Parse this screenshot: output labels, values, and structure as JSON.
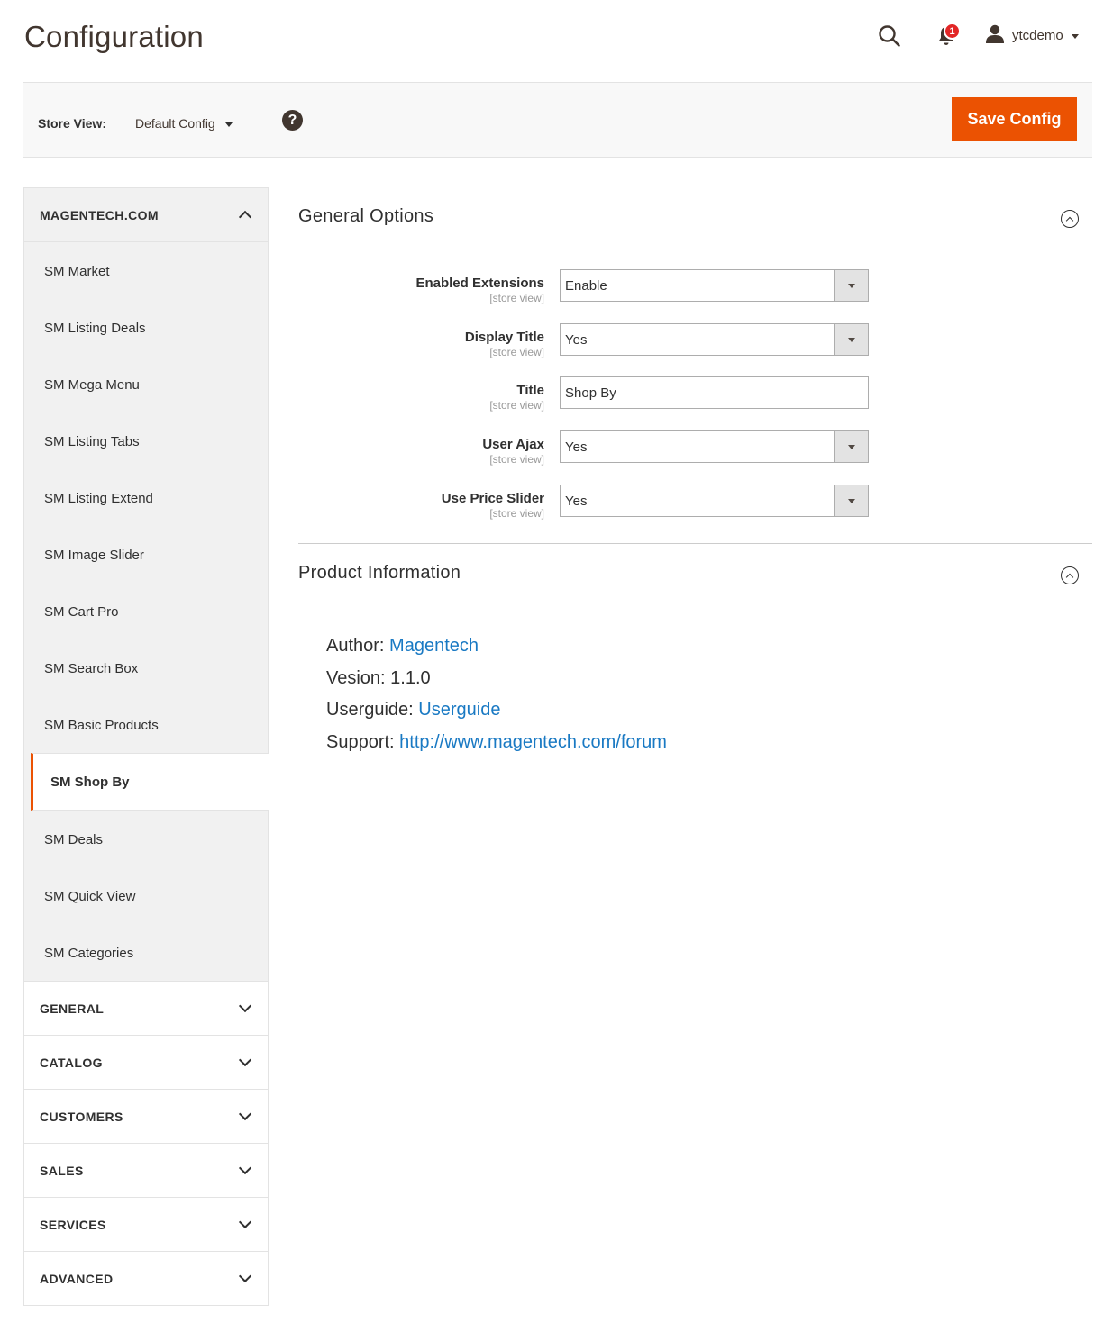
{
  "header": {
    "title": "Configuration",
    "notifications_count": "1",
    "username": "ytcdemo"
  },
  "store_bar": {
    "label": "Store View:",
    "selected": "Default Config",
    "help": "?",
    "save_label": "Save Config"
  },
  "sidebar": {
    "main_section": "MAGENTECH.COM",
    "items": [
      {
        "label": "SM Market"
      },
      {
        "label": "SM Listing Deals"
      },
      {
        "label": "SM Mega Menu"
      },
      {
        "label": "SM Listing Tabs"
      },
      {
        "label": "SM Listing Extend"
      },
      {
        "label": "SM Image Slider"
      },
      {
        "label": "SM Cart Pro"
      },
      {
        "label": "SM Search Box"
      },
      {
        "label": "SM Basic Products"
      },
      {
        "label": "SM Shop By"
      },
      {
        "label": "SM Deals"
      },
      {
        "label": "SM Quick View"
      },
      {
        "label": "SM Categories"
      }
    ],
    "active_item": "SM Shop By",
    "sections": [
      {
        "label": "GENERAL"
      },
      {
        "label": "CATALOG"
      },
      {
        "label": "CUSTOMERS"
      },
      {
        "label": "SALES"
      },
      {
        "label": "SERVICES"
      },
      {
        "label": "ADVANCED"
      }
    ]
  },
  "general_options": {
    "title": "General Options",
    "fields": [
      {
        "label": "Enabled Extensions",
        "scope": "[store view]",
        "value": "Enable",
        "type": "select"
      },
      {
        "label": "Display Title",
        "scope": "[store view]",
        "value": "Yes",
        "type": "select"
      },
      {
        "label": "Title",
        "scope": "[store view]",
        "value": "Shop By",
        "type": "text"
      },
      {
        "label": "User Ajax",
        "scope": "[store view]",
        "value": "Yes",
        "type": "select"
      },
      {
        "label": "Use Price Slider",
        "scope": "[store view]",
        "value": "Yes",
        "type": "select"
      }
    ]
  },
  "product_info": {
    "title": "Product Information",
    "author_label": "Author:",
    "author_link": "Magentech",
    "version_label": "Vesion:",
    "version_value": "1.1.0",
    "guide_label": "Userguide:",
    "guide_link": "Userguide",
    "support_label": "Support:",
    "support_link": "http://www.magentech.com/forum"
  },
  "colors": {
    "accent": "#eb5202",
    "link": "#1979c3",
    "badge": "#e22626"
  }
}
